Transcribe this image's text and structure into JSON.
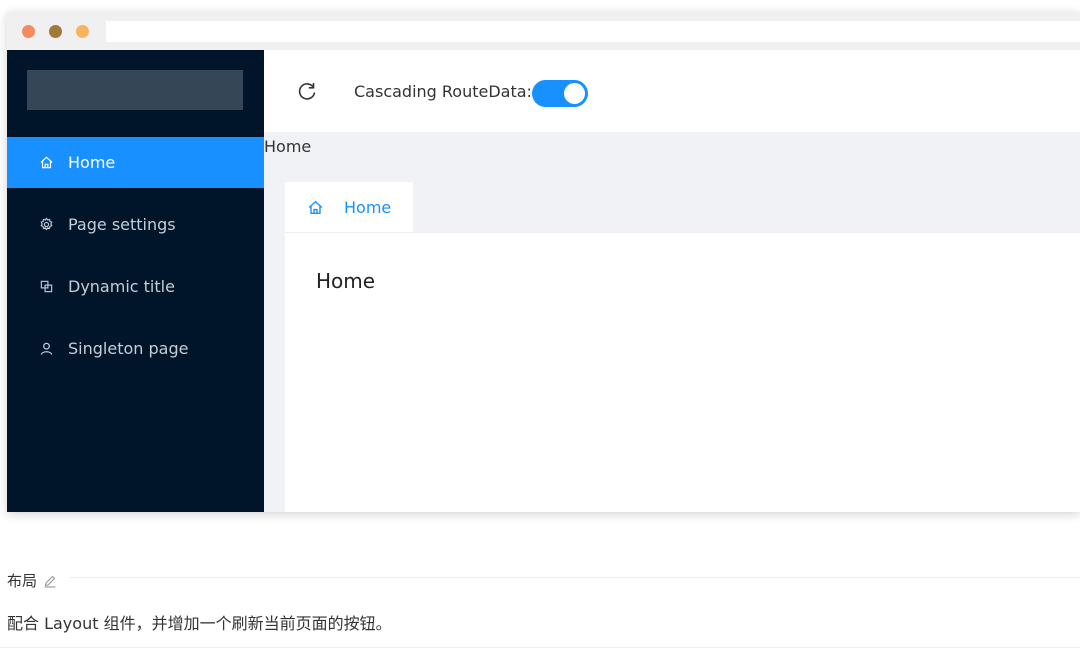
{
  "sidebar": {
    "items": [
      {
        "label": "Home",
        "icon": "home-icon",
        "active": true
      },
      {
        "label": "Page settings",
        "icon": "gear-icon",
        "active": false
      },
      {
        "label": "Dynamic title",
        "icon": "copy-icon",
        "active": false
      },
      {
        "label": "Singleton page",
        "icon": "user-icon",
        "active": false
      }
    ]
  },
  "header": {
    "cascade_label": "Cascading RouteData:",
    "cascade_enabled": true
  },
  "breadcrumb": "Home",
  "tabs": [
    {
      "label": "Home",
      "icon": "home-icon"
    }
  ],
  "content": {
    "title": "Home"
  },
  "doc": {
    "heading": "布局",
    "description": "配合 Layout 组件，并增加一个刷新当前页面的按钮。"
  },
  "colors": {
    "accent": "#1890ff",
    "sidebar_bg": "#001529",
    "main_bg": "#f0f2f5"
  }
}
